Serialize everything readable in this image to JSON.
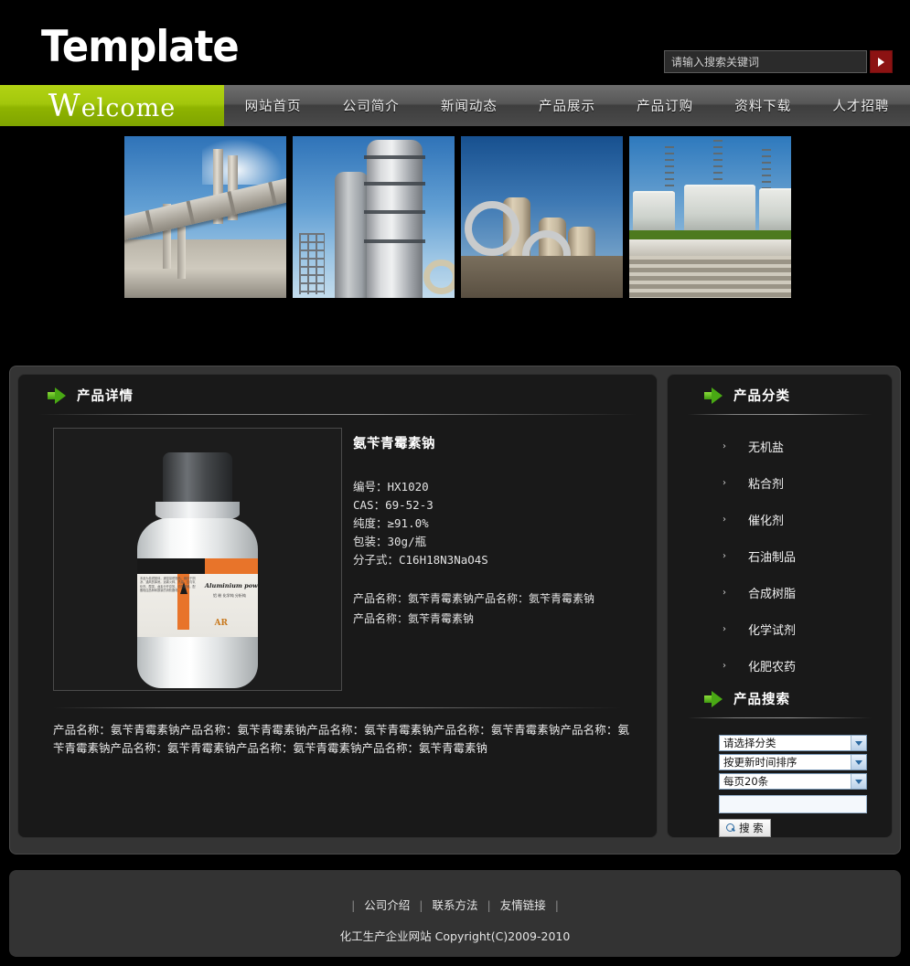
{
  "header": {
    "logo": "Template",
    "search": {
      "placeholder": "请输入搜索关键词",
      "value": "",
      "go_label": "▶"
    }
  },
  "nav": {
    "welcome_first": "W",
    "welcome_rest": "elcome",
    "items": [
      {
        "label": "网站首页"
      },
      {
        "label": "公司简介"
      },
      {
        "label": "新闻动态"
      },
      {
        "label": "产品展示"
      },
      {
        "label": "产品订购"
      },
      {
        "label": "资料下载"
      },
      {
        "label": "人才招聘"
      }
    ]
  },
  "banner": {
    "images": [
      {
        "alt": "水泥厂输送带与烟囱"
      },
      {
        "alt": "炼油厂蒸馏塔"
      },
      {
        "alt": "化工装置管道"
      },
      {
        "alt": "石油储罐区"
      }
    ]
  },
  "product_panel": {
    "title": "产品详情",
    "product": {
      "name": "氨苄青霉素钠",
      "image_label_title": "Aluminium powder",
      "image_label_sub": "铝 粉\n化学纯 分析纯",
      "image_label_grade": "AR",
      "image_label_fine": "本品为易燃固体，遇湿易燃物品。储存于阴凉、通风的库房。远离火种、热源。应与氧化剂、酸类、卤素分开存放，切忌混储。配备相应品种和数量的消防器材。",
      "specs": [
        "编号：HX1020",
        "CAS：69-52-3",
        "纯度：≥91.0%",
        "包装：30g/瓶",
        "分子式：C16H18N3NaO4S"
      ],
      "inline_desc_line1": "产品名称：氨苄青霉素钠产品名称：氨苄青霉素钠",
      "inline_desc_line2": "产品名称：氨苄青霉素钠",
      "description": "产品名称：氨苄青霉素钠产品名称：氨苄青霉素钠产品名称：氨苄青霉素钠产品名称：氨苄青霉素钠产品名称：氨苄青霉素钠产品名称：氨苄青霉素钠产品名称：氨苄青霉素钠产品名称：氨苄青霉素钠"
    }
  },
  "sidebar": {
    "categories_title": "产品分类",
    "categories": [
      {
        "label": "无机盐"
      },
      {
        "label": "粘合剂"
      },
      {
        "label": "催化剂"
      },
      {
        "label": "石油制品"
      },
      {
        "label": "合成树脂"
      },
      {
        "label": "化学试剂"
      },
      {
        "label": "化肥农药"
      }
    ],
    "search_title": "产品搜索",
    "search_form": {
      "category_select": "请选择分类",
      "sort_select": "按更新时间排序",
      "pagesize_select": "每页20条",
      "keyword_value": "",
      "keyword_placeholder": "",
      "button_label": "搜 索"
    }
  },
  "footer": {
    "links": [
      {
        "label": "公司介绍"
      },
      {
        "label": "联系方法"
      },
      {
        "label": "友情链接"
      }
    ],
    "separator": "|",
    "copyright": "化工生产企业网站 Copyright(C)2009-2010"
  },
  "colors": {
    "accent_green": "#a3c70c",
    "panel_bg": "#191919",
    "container_bg": "#343434",
    "page_bg": "#000000",
    "go_button_red": "#8c1212"
  }
}
